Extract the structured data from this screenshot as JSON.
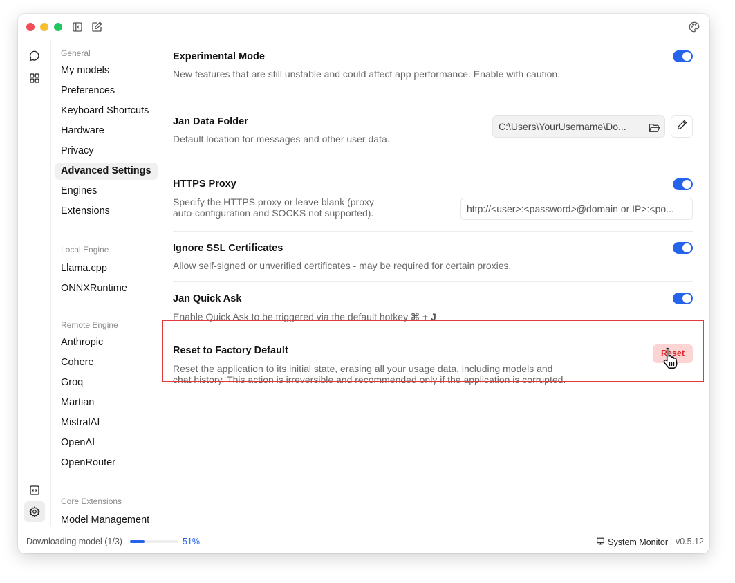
{
  "titlebar": {
    "icons": [
      "sidebar-collapse-icon",
      "new-chat-icon",
      "palette-icon"
    ]
  },
  "rail": {
    "top_icons": [
      "chat-icon",
      "hub-grid-icon"
    ],
    "bottom_icons": [
      "api-server-icon",
      "settings-icon"
    ],
    "active": "settings-icon"
  },
  "sidenav": {
    "groups": [
      {
        "title": "General",
        "items": [
          "My models",
          "Preferences",
          "Keyboard Shortcuts",
          "Hardware",
          "Privacy",
          "Advanced Settings",
          "Engines",
          "Extensions"
        ]
      },
      {
        "title": "Local Engine",
        "items": [
          "Llama.cpp",
          "ONNXRuntime"
        ]
      },
      {
        "title": "Remote Engine",
        "items": [
          "Anthropic",
          "Cohere",
          "Groq",
          "Martian",
          "MistralAI",
          "OpenAI",
          "OpenRouter"
        ]
      },
      {
        "title": "Core Extensions",
        "items": [
          "Model Management"
        ]
      }
    ],
    "active_item": "Advanced Settings"
  },
  "settings": {
    "experimental": {
      "title": "Experimental Mode",
      "description": "New features that are still unstable and could affect app performance. Enable with caution.",
      "enabled": true
    },
    "data_folder": {
      "title": "Jan Data Folder",
      "description": "Default location for messages and other user data.",
      "value": "C:\\Users\\YourUsername\\Do..."
    },
    "https_proxy": {
      "title": "HTTPS Proxy",
      "description_line1": "Specify the HTTPS proxy or leave blank (proxy",
      "description_line2": "auto-configuration and SOCKS not supported).",
      "placeholder": "http://<user>:<password>@domain or IP>:<po...",
      "enabled": true
    },
    "ignore_ssl": {
      "title": "Ignore SSL Certificates",
      "description": "Allow self-signed or unverified certificates - may be required for certain proxies.",
      "enabled": true
    },
    "quick_ask": {
      "title": "Jan Quick Ask",
      "description": "Enable Quick Ask to be triggered via the default hotkey",
      "hotkey": "⌘ + J",
      "enabled": true
    },
    "factory_reset": {
      "title": "Reset to Factory Default",
      "description_line1": "Reset the application to its initial state, erasing all your usage data, including models and",
      "description_line2": "chat history. This action is irreversible and recommended only if the application is corrupted.",
      "button_label": "Reset"
    }
  },
  "statusbar": {
    "download_label": "Downloading model (1/3)",
    "download_percent_label": "51%",
    "progress_bar_fill": 0.3,
    "system_monitor_label": "System Monitor",
    "version": "v0.5.12"
  },
  "colors": {
    "accent": "#2563eb",
    "danger": "#e02424",
    "danger_bg": "#fcd4d4",
    "highlight_border": "#e5383b"
  }
}
